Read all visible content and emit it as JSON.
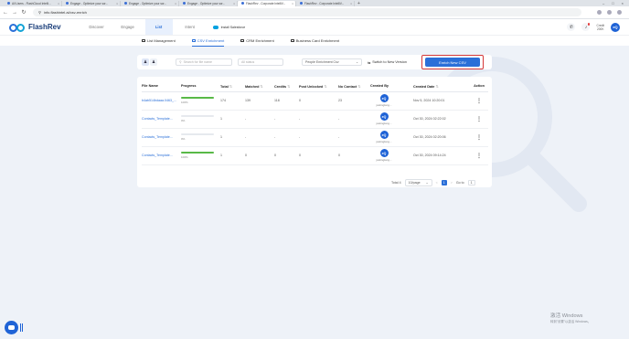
{
  "browser": {
    "tabs": [
      {
        "title": "All Users - FlashCloud Intelli...",
        "active": false
      },
      {
        "title": "Engage - Optimize your scr...",
        "active": false
      },
      {
        "title": "Engage - Optimize your scr...",
        "active": false
      },
      {
        "title": "Engage - Optimize your scr...",
        "active": false
      },
      {
        "title": "FlashRev - Corporate IntelliV...",
        "active": true
      },
      {
        "title": "FlashRev - Corporate IntelliV...",
        "active": false
      }
    ],
    "url": "info.flashintel.ai/csv-enrich"
  },
  "appnav": {
    "logo": "FlashRev",
    "items": [
      "Discover",
      "Engage",
      "List",
      "Intent"
    ],
    "active_item": "List",
    "salesforce_badge": "Install Salesforce",
    "credit_text": "Credit",
    "credit_value": "200K",
    "avatar_initials": "eQ"
  },
  "subnav": {
    "items": [
      "List Management",
      "CSV Enrichment",
      "CRM Enrichment",
      "Business Card Enrichment"
    ],
    "active": "CSV Enrichment"
  },
  "toolbar": {
    "search_placeholder": "Search for file name",
    "status_placeholder": "All status",
    "enrichment_select": "People Enrichment Csv",
    "sync_label": "Switch to New Version",
    "enrich_button": "Enrich New CSV"
  },
  "table": {
    "columns": [
      "File Name",
      "Progress",
      "Total",
      "Matched",
      "Credits",
      "Post Unlocked",
      "No Contact",
      "Created By",
      "Created Date",
      "Action"
    ],
    "rows": [
      {
        "file": "b4ab514bdaaa.0463_...",
        "progress": 100,
        "progress_label": "100%",
        "total": "174",
        "matched": "139",
        "credits": "118",
        "post_unlocked": "0",
        "no_contact": "23",
        "avatar": "eQ",
        "created_by": "justinglong...",
        "date": "Nov 5, 2024 10:20:01"
      },
      {
        "file": "Contacts_Template...",
        "progress": 0,
        "progress_label": "0%",
        "total": "1",
        "matched": "-",
        "credits": "-",
        "post_unlocked": "-",
        "no_contact": "-",
        "avatar": "eQ",
        "created_by": "justinglong...",
        "date": "Oct 30, 2024 02:22:02"
      },
      {
        "file": "Contacts_Template...",
        "progress": 0,
        "progress_label": "0%",
        "total": "1",
        "matched": "-",
        "credits": "-",
        "post_unlocked": "-",
        "no_contact": "-",
        "avatar": "eQ",
        "created_by": "justinglong...",
        "date": "Oct 30, 2024 02:20:06"
      },
      {
        "file": "Contacts_Template...",
        "progress": 100,
        "progress_label": "100%",
        "total": "1",
        "matched": "0",
        "credits": "0",
        "post_unlocked": "0",
        "no_contact": "0",
        "avatar": "eQ",
        "created_by": "justinglong...",
        "date": "Oct 30, 2024 09:14:24"
      }
    ]
  },
  "pagination": {
    "total": "Total 4",
    "page_size": "10/page",
    "prev": "<",
    "current": "1",
    "next": ">",
    "goto_label": "Go to",
    "goto_value": "1"
  },
  "activation": {
    "line1": "激活 Windows",
    "line2": "转到\"设置\"以激活 Windows。"
  },
  "colors": {
    "primary": "#2a6fd8",
    "progress": "#58b947",
    "highlight": "#d43838",
    "background": "#eef2f8"
  }
}
